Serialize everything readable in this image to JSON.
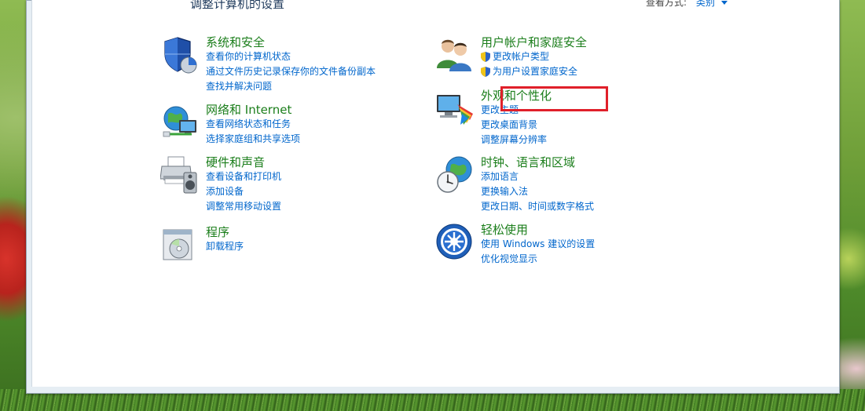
{
  "header": {
    "title": "调整计算机的设置",
    "view_by_label": "查看方式:",
    "view_by_value": "类别"
  },
  "categories": [
    {
      "title": "系统和安全",
      "icon": "shield-icon",
      "links": [
        "查看你的计算机状态",
        "通过文件历史记录保存你的文件备份副本",
        "查找并解决问题"
      ]
    },
    {
      "title": "网络和 Internet",
      "icon": "network-globe-icon",
      "links": [
        "查看网络状态和任务",
        "选择家庭组和共享选项"
      ]
    },
    {
      "title": "硬件和声音",
      "icon": "printer-speaker-icon",
      "links": [
        "查看设备和打印机",
        "添加设备",
        "调整常用移动设置"
      ]
    },
    {
      "title": "程序",
      "icon": "programs-disc-icon",
      "links": [
        "卸载程序"
      ]
    },
    {
      "title": "用户帐户和家庭安全",
      "icon": "users-icon",
      "links": [
        "更改帐户类型",
        "为用户设置家庭安全"
      ]
    },
    {
      "title": "外观和个性化",
      "icon": "monitor-palette-icon",
      "links": [
        "更改主题",
        "更改桌面背景",
        "调整屏幕分辨率"
      ]
    },
    {
      "title": "时钟、语言和区域",
      "icon": "clock-globe-icon",
      "links": [
        "添加语言",
        "更换输入法",
        "更改日期、时间或数字格式"
      ]
    },
    {
      "title": "轻松使用",
      "icon": "ease-of-access-icon",
      "links": [
        "使用 Windows 建议的设置",
        "优化视觉显示"
      ]
    }
  ],
  "colors": {
    "category_title": "#1b7e1b",
    "link": "#0066cc",
    "highlight": "#e0202a"
  }
}
